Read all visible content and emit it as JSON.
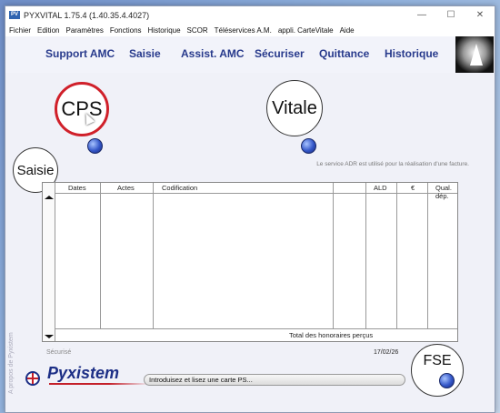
{
  "window": {
    "title": "PYXVITAL 1.75.4 (1.40.35.4.4027)",
    "icon_label": "PV",
    "controls": {
      "minimize": "—",
      "maximize": "☐",
      "close": "✕"
    }
  },
  "menu": [
    "Fichier",
    "Edition",
    "Paramètres",
    "Fonctions",
    "Historique",
    "SCOR",
    "Téléservices A.M.",
    "appli. CarteVitale",
    "Aide"
  ],
  "nav": {
    "items": [
      "Support AMC",
      "Saisie",
      "Assist. AMC",
      "Sécuriser",
      "Quittance",
      "Historique"
    ],
    "color": "#283a8c"
  },
  "cards": {
    "cps_label": "CPS",
    "vitale_label": "Vitale",
    "saisie_label": "Saisie",
    "fse_label": "FSE",
    "cps_ring_color": "#d0202a"
  },
  "adr_note": "Le service ADR est utilisé pour la réalisation d'une facture.",
  "table": {
    "columns": [
      "Dates",
      "Actes",
      "Codification",
      "",
      "ALD",
      "€",
      "Qual. dép."
    ],
    "rows": [],
    "total_label": "Total des honoraires perçus"
  },
  "status": {
    "secure_label": "Sécurisé",
    "date": "17/02/26",
    "side_text": "A propos de Pyxistem"
  },
  "brand": {
    "name": "Pyxistem"
  },
  "message": "Introduisez et lisez une carte PS..."
}
